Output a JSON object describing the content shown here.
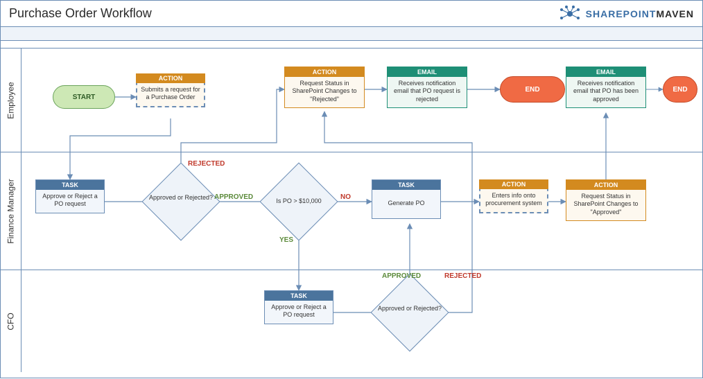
{
  "title": "Purchase Order Workflow",
  "logo": {
    "part1": "SHAREP",
    "dot": "O",
    "part2": "INT",
    "part3": "MAVEN"
  },
  "lanes": {
    "employee": "Employee",
    "finance": "Finance Manager",
    "cfo": "CFO"
  },
  "nodes": {
    "start": "START",
    "end1": "END",
    "end2": "END",
    "action_submit": {
      "hdr": "ACTION",
      "txt": "Submits a request for a Purchase Order"
    },
    "action_rejected_status": {
      "hdr": "ACTION",
      "txt": "Request Status in SharePoint Changes to \"Rejected\""
    },
    "email_rejected": {
      "hdr": "EMAIL",
      "txt": "Receives notification email that PO request is rejected"
    },
    "email_approved": {
      "hdr": "EMAIL",
      "txt": "Receives notification email that PO has been approved"
    },
    "task_fm_approve": {
      "hdr": "TASK",
      "txt": "Approve or Reject a PO request"
    },
    "decision_fm": "Approved or Rejected?",
    "decision_amount": "Is PO > $10,000",
    "task_generate_po": {
      "hdr": "TASK",
      "txt": "Generate PO"
    },
    "action_procurement": {
      "hdr": "ACTION",
      "txt": "Enters info onto procurement system"
    },
    "action_approved_status": {
      "hdr": "ACTION",
      "txt": "Request Status in SharePoint Changes to \"Approved\""
    },
    "task_cfo_approve": {
      "hdr": "TASK",
      "txt": "Approve or Reject a PO request"
    },
    "decision_cfo": "Approved or Rejected?"
  },
  "labels": {
    "rejected": "REJECTED",
    "approved": "APPROVED",
    "yes": "YES",
    "no": "NO"
  }
}
